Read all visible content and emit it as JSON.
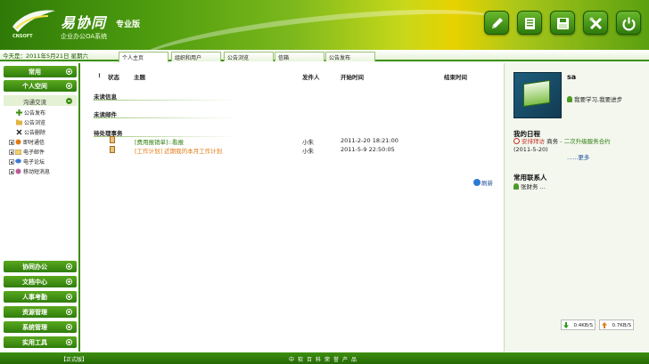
{
  "header": {
    "brand": "易协同",
    "edition": "专业版",
    "sub_brand": "企业办公OA系统",
    "logo_caption": "CNSOFT",
    "toolbar": [
      "pencil-icon",
      "document-list-icon",
      "save-icon",
      "tools-icon",
      "power-icon"
    ]
  },
  "nav": {
    "today": "今天是：2011年5月21日 星期六",
    "tabs": [
      {
        "label": "个人主页",
        "active": true
      },
      {
        "label": "组织和用户",
        "active": false
      },
      {
        "label": "公告浏览",
        "active": false
      },
      {
        "label": "信箱",
        "active": false
      },
      {
        "label": "公告发布",
        "active": false
      }
    ]
  },
  "sidebar": {
    "top": [
      {
        "label": "常用"
      },
      {
        "label": "个人空间"
      }
    ],
    "sub": {
      "label": "沟通交流"
    },
    "tree": [
      {
        "label": "公告发布",
        "icon": "add-icon",
        "level": 2
      },
      {
        "label": "公告浏览",
        "icon": "folder-icon",
        "level": 2
      },
      {
        "label": "公告删除",
        "icon": "delete-icon",
        "level": 2
      },
      {
        "label": "即时通信",
        "icon": "message-icon",
        "level": 1
      },
      {
        "label": "电子邮件",
        "icon": "mail-icon",
        "level": 1
      },
      {
        "label": "电子论坛",
        "icon": "forum-icon",
        "level": 1
      },
      {
        "label": "移动短消息",
        "icon": "sms-icon",
        "level": 1
      }
    ],
    "bottom": [
      {
        "label": "协同办公"
      },
      {
        "label": "文档中心"
      },
      {
        "label": "人事考勤"
      },
      {
        "label": "资源管理"
      },
      {
        "label": "系统管理"
      },
      {
        "label": "实用工具"
      }
    ]
  },
  "main": {
    "columns": {
      "flag": "!",
      "status": "状态",
      "subject": "主题",
      "sender": "发件人",
      "start": "开始时间",
      "end": "结束时间"
    },
    "sections": {
      "unread_info": "未读信息",
      "unread_mail": "未读邮件",
      "pending": "待处理事务"
    },
    "tasks": [
      {
        "subject": "[费用报销单]::看报",
        "sender": "小朱",
        "start": "2011-2-20 18:21:00",
        "end": "",
        "color": "#2f7d0c"
      },
      {
        "subject": "[工作计划] 近期我的本月工作计划",
        "sender": "小朱",
        "start": "2011-5-9 22:50:05",
        "end": "",
        "color": "#e07a14"
      }
    ],
    "refresh": "刷新"
  },
  "right": {
    "username": "sa",
    "motto": "我要学习,我要进步",
    "schedule_title": "我的日程",
    "schedule": {
      "label": "安排拜访",
      "who": "商务",
      "dash": "-",
      "task": "二次升级服务合约",
      "date": "(2011-5-20)"
    },
    "more": "......更多",
    "contacts_title": "常用联系人",
    "contact": "张财务 ..."
  },
  "status": {
    "download": "0.4KB/S",
    "upload": "0.7KB/S",
    "download_color": "#2f9a1a",
    "upload_color": "#e07a14"
  },
  "footer": {
    "version": "【正式版】",
    "slogan": "中软百科荣誉产品"
  }
}
